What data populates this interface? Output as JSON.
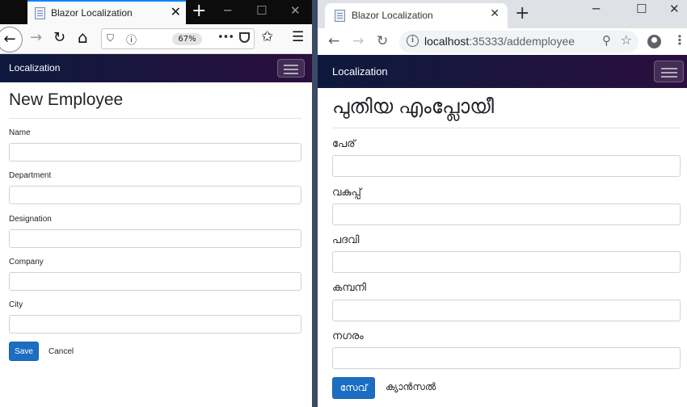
{
  "left_browser": {
    "tab_title": "Blazor Localization",
    "tab_close": "✕",
    "new_tab": "+",
    "window_controls": {
      "minimize": "─",
      "maximize": "☐",
      "close": "✕"
    },
    "toolbar": {
      "back": "←",
      "forward": "→",
      "reload": "↻",
      "home": "⌂",
      "more": "•••",
      "menu": "☰"
    },
    "zoom_level": "67%",
    "app": {
      "brand": "Localization",
      "title": "New Employee",
      "fields": [
        {
          "label": "Name",
          "value": ""
        },
        {
          "label": "Department",
          "value": ""
        },
        {
          "label": "Designation",
          "value": ""
        },
        {
          "label": "Company",
          "value": ""
        },
        {
          "label": "City",
          "value": ""
        }
      ],
      "save_label": "Save",
      "cancel_label": "Cancel"
    }
  },
  "right_browser": {
    "tab_title": "Blazor Localization",
    "tab_close": "✕",
    "new_tab": "+",
    "window_controls": {
      "minimize": "─",
      "maximize": "☐",
      "close": "✕"
    },
    "toolbar": {
      "back": "←",
      "forward": "→",
      "reload": "↻",
      "menu": "⋮"
    },
    "url_host": "localhost",
    "url_rest": ":35333/addemployee",
    "app": {
      "brand": "Localization",
      "title": "പുതിയ എംപ്ലോയീ",
      "fields": [
        {
          "label": "പേര്",
          "value": ""
        },
        {
          "label": "വകുപ്പ്",
          "value": ""
        },
        {
          "label": "പദവി",
          "value": ""
        },
        {
          "label": "കമ്പനി",
          "value": ""
        },
        {
          "label": "നഗരം",
          "value": ""
        }
      ],
      "save_label": "സേവ്",
      "cancel_label": "ക്യാൻസൽ"
    }
  },
  "colors": {
    "primary_button": "#1b6ec2",
    "navbar_start": "#0d1a3d",
    "navbar_end": "#2b0f3e",
    "firefox_tab_accent": "#0a84ff"
  },
  "icons": [
    "favicon-page-icon",
    "back-arrow-icon",
    "forward-arrow-icon",
    "reload-icon",
    "home-icon",
    "shield-icon",
    "info-icon",
    "pocket-icon",
    "bookmarks-icon",
    "hamburger-menu-icon",
    "zoom-magnifier-icon",
    "star-icon",
    "profile-avatar-icon",
    "kebab-menu-icon"
  ]
}
